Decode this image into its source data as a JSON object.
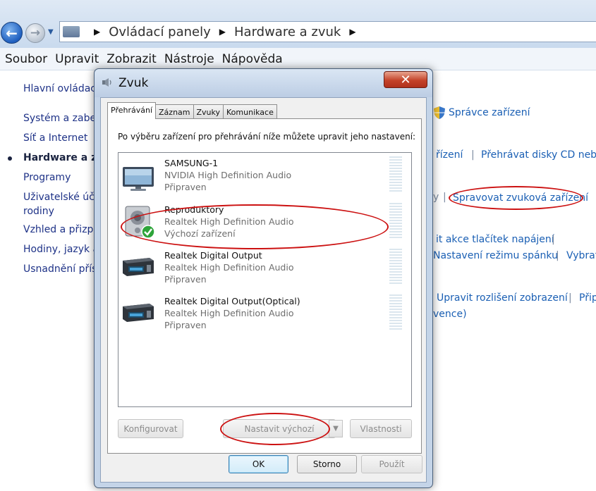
{
  "explorer": {
    "breadcrumb": [
      "Ovládací panely",
      "Hardware a zvuk"
    ],
    "menu": [
      "Soubor",
      "Upravit",
      "Zobrazit",
      "Nástroje",
      "Nápověda"
    ],
    "left_nav": {
      "home": "Hlavní ovládac",
      "items": [
        "Systém a zabez",
        "Síť a Internet",
        "Hardware a zv",
        "Programy",
        "Uživatelské účt",
        "rodiny",
        "Vzhled a přizpů",
        "Hodiny, jazyk a",
        "Usnadnění příst"
      ]
    },
    "right_links": {
      "device_manager": "Správce zařízení",
      "devices_partial": "řízení",
      "play_cd": "Přehrávat disky CD nebo",
      "manage_audio": "Spravovat zvuková zařízení",
      "power_buttons": "it akce tlačítek napájení",
      "sleep_mode": "Nastavení režimu spánku",
      "select_partial": "Vybrat",
      "resolution": "Upravit rozlišení zobrazení",
      "pri_partial": "Přip",
      "vence": "vence)"
    }
  },
  "dialog": {
    "title": "Zvuk",
    "close_glyph": "✕",
    "tabs": [
      "Přehrávání",
      "Záznam",
      "Zvuky",
      "Komunikace"
    ],
    "instruction": "Po výběru zařízení pro přehrávání níže můžete upravit jeho nastavení:",
    "devices": [
      {
        "name": "SAMSUNG-1",
        "driver": "NVIDIA High Definition Audio",
        "status": "Připraven",
        "icon": "monitor-icon"
      },
      {
        "name": "Reproduktory",
        "driver": "Realtek High Definition Audio",
        "status": "Výchozí zařízení",
        "icon": "speaker-default-icon"
      },
      {
        "name": "Realtek Digital Output",
        "driver": "Realtek High Definition Audio",
        "status": "Připraven",
        "icon": "digital-output-icon"
      },
      {
        "name": "Realtek Digital Output(Optical)",
        "driver": "Realtek High Definition Audio",
        "status": "Připraven",
        "icon": "digital-output-icon"
      }
    ],
    "buttons": {
      "configure": "Konfigurovat",
      "set_default": "Nastavit výchozí",
      "properties": "Vlastnosti",
      "ok": "OK",
      "cancel": "Storno",
      "apply": "Použít"
    }
  },
  "colors": {
    "annotation": "#cc1111",
    "link": "#1a5fb4",
    "close_button": "#c4432a"
  }
}
